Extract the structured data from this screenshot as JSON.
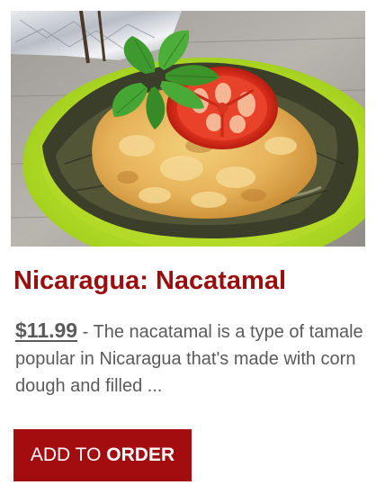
{
  "product": {
    "title": "Nicaragua: Nacatamal",
    "price": "$11.99",
    "separator": " - ",
    "description": "The nacatamal is a type of tamale popular in Nicaragua that's made with corn dough and filled ...",
    "image_subject": "nacatamal on banana leaf with tomato slice and mint garnish on green plate"
  },
  "button": {
    "label_prefix": "ADD TO ",
    "label_emphasis": "ORDER"
  },
  "colors": {
    "title": "#9b0e0e",
    "text": "#5a5a5a",
    "button_bg": "#a30d10"
  }
}
